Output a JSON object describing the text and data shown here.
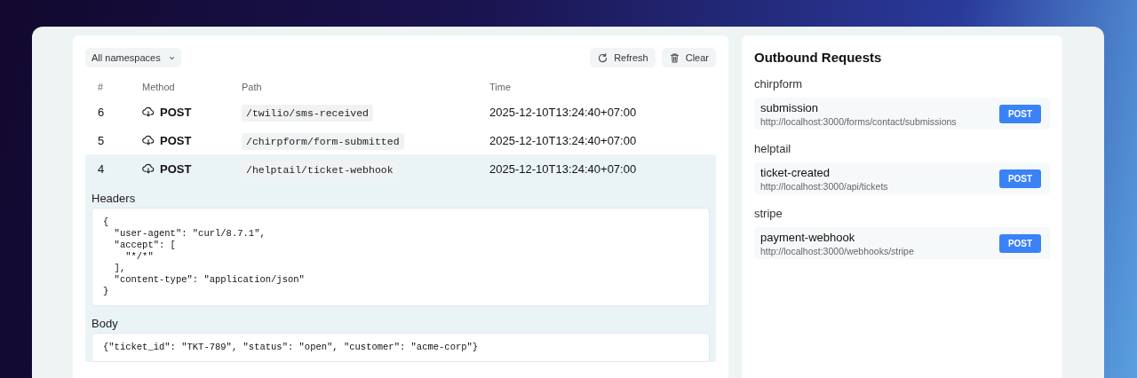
{
  "toolbar": {
    "namespace_select": "All namespaces",
    "buttons": [
      {
        "kind": "refresh",
        "label": "Refresh"
      },
      {
        "kind": "clear",
        "label": "Clear"
      }
    ]
  },
  "table": {
    "columns": [
      "#",
      "Method",
      "Path",
      "Time"
    ],
    "rows": [
      {
        "number": "6",
        "method": "POST",
        "path": "/twilio/sms-received",
        "time": "2025-12-10T13:24:40+07:00",
        "selected": false
      },
      {
        "number": "5",
        "method": "POST",
        "path": "/chirpform/form-submitted",
        "time": "2025-12-10T13:24:40+07:00",
        "selected": false
      },
      {
        "number": "4",
        "method": "POST",
        "path": "/helptail/ticket-webhook",
        "time": "2025-12-10T13:24:40+07:00",
        "selected": true,
        "details": {
          "headers_label": "Headers",
          "headers": "{\n  \"user-agent\": \"curl/8.7.1\",\n  \"accept\": [\n    \"*/*\"\n  ],\n  \"content-type\": \"application/json\"\n}",
          "body_label": "Body",
          "body": "{\"ticket_id\": \"TKT-789\", \"status\": \"open\", \"customer\": \"acme-corp\"}"
        }
      }
    ]
  },
  "outbound": {
    "title": "Outbound Requests",
    "groups": [
      {
        "name": "chirpform",
        "requests": [
          {
            "name": "submission",
            "url": "http://localhost:3000/forms/contact/submissions",
            "method": "POST"
          }
        ]
      },
      {
        "name": "helptail",
        "requests": [
          {
            "name": "ticket-created",
            "url": "http://localhost:3000/api/tickets",
            "method": "POST"
          }
        ]
      },
      {
        "name": "stripe",
        "requests": [
          {
            "name": "payment-webhook",
            "url": "http://localhost:3000/webhooks/stripe",
            "method": "POST"
          }
        ]
      }
    ]
  }
}
